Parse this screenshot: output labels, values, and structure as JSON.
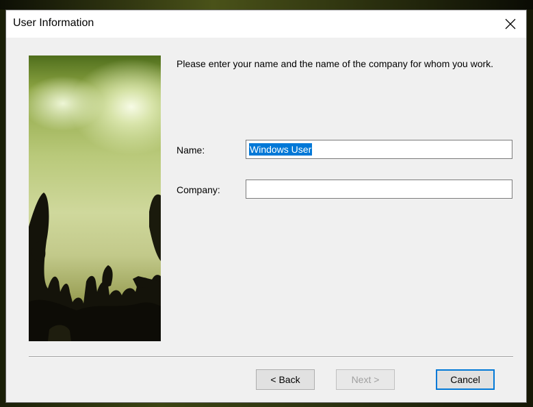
{
  "window": {
    "title": "User Information",
    "close_icon": "close-icon"
  },
  "content": {
    "prompt": "Please enter your name and the name of the company for whom you work.",
    "name_label": "Name:",
    "name_value": "Windows User",
    "company_label": "Company:",
    "company_value": ""
  },
  "buttons": {
    "back": "< Back",
    "next": "Next >",
    "cancel": "Cancel"
  },
  "colors": {
    "selection": "#0078d7",
    "dialog_bg": "#f0f0f0"
  }
}
